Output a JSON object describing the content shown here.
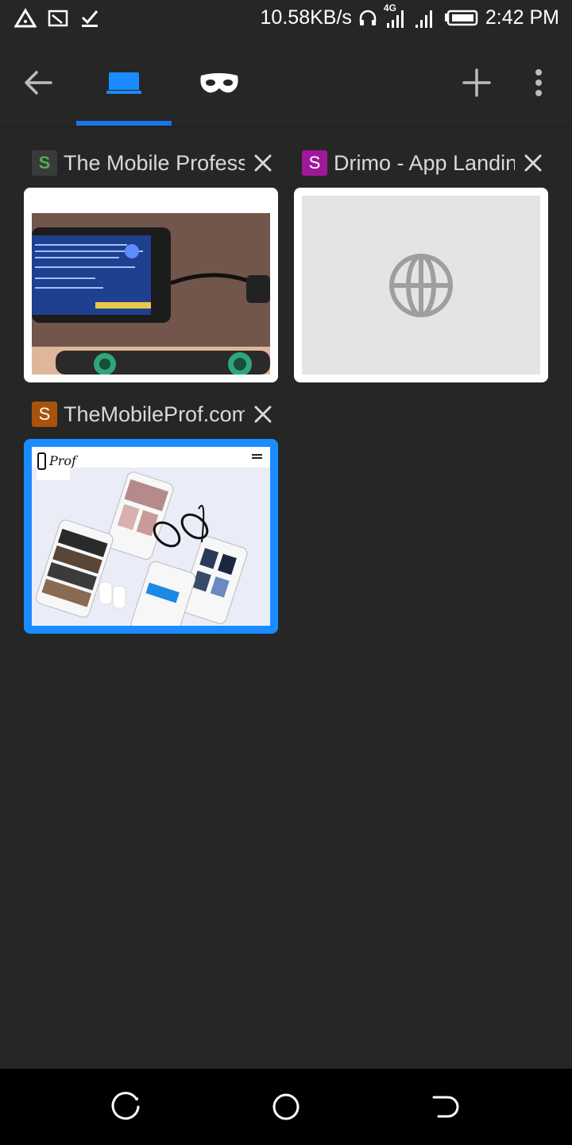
{
  "status_bar": {
    "net_speed": "10.58KB/s",
    "network_type": "4G",
    "time": "2:42 PM",
    "icons": [
      "warning-triangle-icon",
      "screencast-icon",
      "download-done-icon",
      "headphones-icon",
      "signal-icon",
      "signal-icon",
      "battery-icon"
    ]
  },
  "toolbar": {
    "back_icon": "arrow-left-icon",
    "normal_tabs_icon": "tabs-icon",
    "incognito_icon": "incognito-mask-icon",
    "new_tab_icon": "plus-icon",
    "menu_icon": "more-vertical-icon"
  },
  "tabs": [
    {
      "favicon_letter": "S",
      "favicon_color": "#2e7d32",
      "title": "The Mobile Professor",
      "selected": false
    },
    {
      "favicon_letter": "S",
      "favicon_color": "#a0189a",
      "title": "Drimo - App Landing",
      "selected": false
    },
    {
      "favicon_letter": "S",
      "favicon_color": "#a8520c",
      "title": "TheMobileProf.com",
      "selected": true
    }
  ],
  "thumb3_logo_text": "Prof",
  "colors": {
    "accent": "#1a73e8",
    "background": "#262626"
  },
  "nav_bar": {
    "icons": [
      "recents-icon",
      "home-icon",
      "back-icon"
    ]
  }
}
